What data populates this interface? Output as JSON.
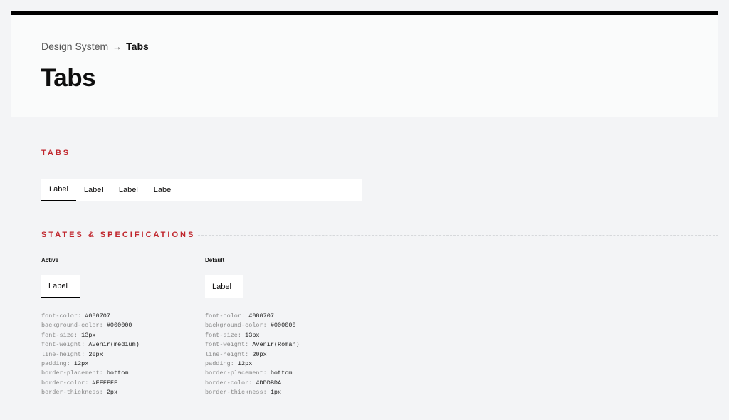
{
  "breadcrumb": {
    "parent": "Design System",
    "arrow": "→",
    "current": "Tabs"
  },
  "page_title": "Tabs",
  "sections": {
    "tabs": "TABS",
    "states": "STATES & SPECIFICATIONS"
  },
  "tabs": [
    {
      "label": "Label",
      "active": true
    },
    {
      "label": "Label",
      "active": false
    },
    {
      "label": "Label",
      "active": false
    },
    {
      "label": "Label",
      "active": false
    }
  ],
  "states": {
    "active": {
      "title": "Active",
      "sample_label": "Label",
      "specs": [
        {
          "k": "font-color:",
          "v": "#080707"
        },
        {
          "k": "background-color:",
          "v": "#000000"
        },
        {
          "k": "font-size:",
          "v": "13px"
        },
        {
          "k": "font-weight:",
          "v": "Avenir(medium)"
        },
        {
          "k": "line-height:",
          "v": "20px"
        },
        {
          "k": "padding:",
          "v": "12px"
        },
        {
          "k": "border-placement:",
          "v": "bottom"
        },
        {
          "k": "border-color:",
          "v": "#FFFFFF"
        },
        {
          "k": "border-thickness:",
          "v": "2px"
        }
      ]
    },
    "default": {
      "title": "Default",
      "sample_label": "Label",
      "specs": [
        {
          "k": "font-color:",
          "v": "#080707"
        },
        {
          "k": "background-color:",
          "v": "#000000"
        },
        {
          "k": "font-size:",
          "v": "13px"
        },
        {
          "k": "font-weight:",
          "v": "Avenir(Roman)"
        },
        {
          "k": "line-height:",
          "v": "20px"
        },
        {
          "k": "padding:",
          "v": "12px"
        },
        {
          "k": "border-placement:",
          "v": "bottom"
        },
        {
          "k": "border-color:",
          "v": "#DDDBDA"
        },
        {
          "k": "border-thickness:",
          "v": "1px"
        }
      ]
    }
  },
  "colors": {
    "accent": "#c0262d",
    "text": "#080707",
    "border": "#dddbda"
  }
}
